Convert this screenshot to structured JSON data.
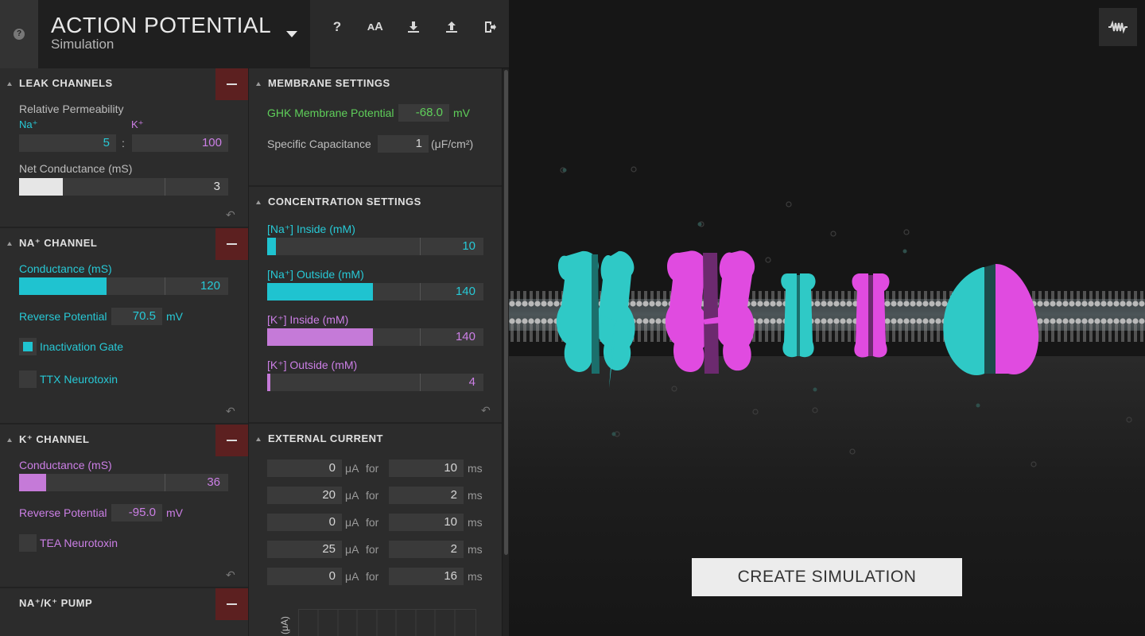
{
  "header": {
    "help_glyph": "?",
    "title": "ACTION POTENTIAL",
    "subtitle": "Simulation",
    "tools": [
      "help-icon",
      "text-size-icon",
      "download-icon",
      "upload-icon",
      "exit-icon"
    ]
  },
  "leak": {
    "title": "LEAK CHANNELS",
    "rel_perm_label": "Relative Permeability",
    "na_label": "Na⁺",
    "k_label": "K⁺",
    "na_value": "5",
    "ratio_sep": ":",
    "k_value": "100",
    "net_cond_label": "Net Conductance (mS)",
    "net_cond_value": "3",
    "net_cond_fraction": 0.21
  },
  "na_channel": {
    "title": "NA⁺ CHANNEL",
    "cond_label": "Conductance (mS)",
    "cond_value": "120",
    "cond_fraction": 0.42,
    "rev_label": "Reverse Potential",
    "rev_value": "70.5",
    "rev_unit": "mV",
    "inact_label": "Inactivation Gate",
    "inact_checked": true,
    "ttx_label": "TTX Neurotoxin",
    "ttx_checked": false
  },
  "k_channel": {
    "title": "K⁺ CHANNEL",
    "cond_label": "Conductance (mS)",
    "cond_value": "36",
    "cond_fraction": 0.13,
    "rev_label": "Reverse Potential",
    "rev_value": "-95.0",
    "rev_unit": "mV",
    "tea_label": "TEA Neurotoxin",
    "tea_checked": false
  },
  "pump": {
    "title": "NA⁺/K⁺ PUMP"
  },
  "membrane": {
    "title": "MEMBRANE SETTINGS",
    "ghk_label": "GHK Membrane Potential",
    "ghk_value": "-68.0",
    "ghk_unit": "mV",
    "cap_label": "Specific Capacitance",
    "cap_value": "1",
    "cap_unit": "(μF/cm²)"
  },
  "concentration": {
    "title": "CONCENTRATION SETTINGS",
    "rows": [
      {
        "label": "[Na⁺] Inside (mM)",
        "value": "10",
        "fraction": 0.04
      },
      {
        "label": "[Na⁺] Outside (mM)",
        "value": "140",
        "fraction": 0.49
      },
      {
        "label": "[K⁺] Inside (mM)",
        "value": "140",
        "fraction": 0.49
      },
      {
        "label": "[K⁺] Outside (mM)",
        "value": "4",
        "fraction": 0.015
      }
    ]
  },
  "external": {
    "title": "EXTERNAL CURRENT",
    "current_unit": "μA",
    "for_word": "for",
    "time_unit": "ms",
    "rows": [
      {
        "current": "0",
        "duration": "10"
      },
      {
        "current": "20",
        "duration": "2"
      },
      {
        "current": "0",
        "duration": "10"
      },
      {
        "current": "25",
        "duration": "2"
      },
      {
        "current": "0",
        "duration": "16"
      }
    ],
    "graph_axis_label": "(μA)"
  },
  "stage": {
    "create_label": "CREATE SIMULATION",
    "graph_toggle_icon": "waveform-icon"
  },
  "colors": {
    "na": "#1fc3d0",
    "k": "#c57ad8",
    "accent_remove": "#5c2020",
    "ghk": "#5fcf5a"
  }
}
